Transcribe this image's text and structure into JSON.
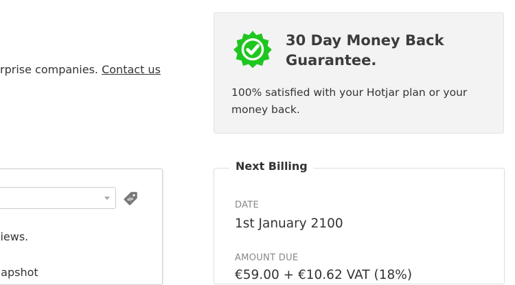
{
  "enterprise": {
    "text": "rprise companies. ",
    "contact_link": "Contact us"
  },
  "guarantee": {
    "badge_icon": "check-badge-icon",
    "badge_color": "#1fc61f",
    "title": "30 Day Money Back Guarantee.",
    "text": "100% satisfied with your Hotjar plan or your money back."
  },
  "billing": {
    "legend": "Next Billing",
    "date_label": "DATE",
    "date_value": "1st January 2100",
    "amount_label": "AMOUNT DUE",
    "amount_value": "€59.00 + €10.62 VAT (18%)"
  },
  "plan_card": {
    "coupon_select_value": "",
    "coupon_icon": "discount-tag-icon",
    "views_text": "views.",
    "snapshot_text": "napshot"
  }
}
